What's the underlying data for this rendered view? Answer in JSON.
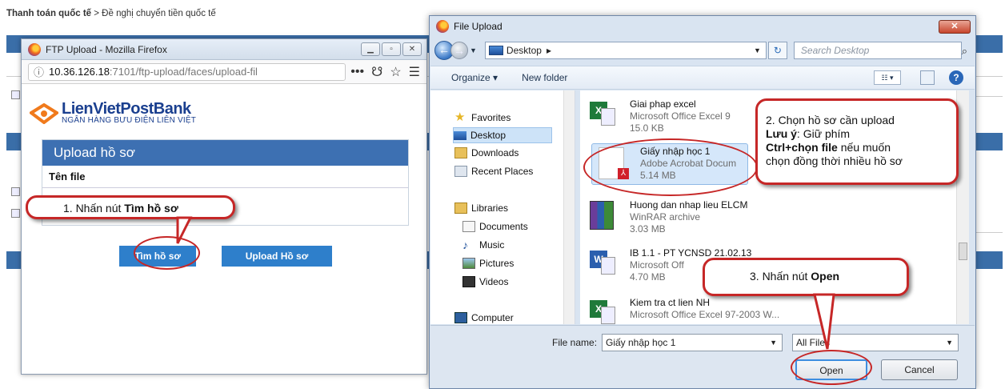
{
  "breadcrumb": {
    "bold": "Thanh toán quốc tế",
    "sep": " > ",
    "rest": "Đề nghị chuyển tiền quốc tế"
  },
  "ftp_window": {
    "title": "FTP Upload - Mozilla Firefox",
    "url_host": "10.36.126.18",
    "url_rest": ":7101/ftp-upload/faces/upload-fil",
    "bank_name": "LienVietPostBank",
    "bank_sub": "NGÂN HÀNG BƯU ĐIỆN LIÊN VIỆT",
    "panel_title": "Upload hồ sơ",
    "column": "Tên file",
    "find_button": "Tìm hồ sơ",
    "upload_button": "Upload Hồ sơ"
  },
  "dialog": {
    "title": "File Upload",
    "path": "Desktop",
    "search_placeholder": "Search Desktop",
    "organize": "Organize ▾",
    "new_folder": "New folder",
    "tree": [
      {
        "label": "Favorites",
        "icon": "star-icon"
      },
      {
        "label": "Desktop",
        "icon": "desktop-icon"
      },
      {
        "label": "Downloads",
        "icon": "downloads-icon"
      },
      {
        "label": "Recent Places",
        "icon": "recent-places-icon"
      },
      {
        "label": "Libraries",
        "icon": "libraries-icon"
      },
      {
        "label": "Documents",
        "icon": "documents-icon"
      },
      {
        "label": "Music",
        "icon": "music-icon"
      },
      {
        "label": "Pictures",
        "icon": "pictures-icon"
      },
      {
        "label": "Videos",
        "icon": "videos-icon"
      },
      {
        "label": "Computer",
        "icon": "computer-icon"
      }
    ],
    "files": [
      {
        "name": "Giai phap excel",
        "type": "Microsoft Office Excel 9",
        "size": "15.0 KB",
        "icon": "excel-icon"
      },
      {
        "name": "Giấy nhập học 1",
        "type": "Adobe Acrobat Docum",
        "size": "5.14 MB",
        "icon": "pdf-icon"
      },
      {
        "name": "Huong dan nhap lieu ELCM",
        "type": "WinRAR archive",
        "size": "3.03 MB",
        "icon": "winrar-icon"
      },
      {
        "name": "IB 1.1 - PT YCNSD 21.02.13",
        "type": "Microsoft Off",
        "size": "4.70 MB",
        "icon": "word-icon"
      },
      {
        "name": "Kiem tra ct lien NH",
        "type": "Microsoft Office Excel 97-2003 W...",
        "size": "",
        "icon": "excel-icon"
      }
    ],
    "filename_label": "File name:",
    "filename_value": "Giấy nhập học 1",
    "filter_value": "All Files",
    "open_button": "Open",
    "cancel_button": "Cancel"
  },
  "callouts": {
    "step1_text": "1. Nhấn nút ",
    "step1_bold": "Tìm hồ sơ",
    "step2_line1": "2. Chọn hồ sơ cần upload",
    "step2_bold1": "Lưu ý",
    "step2_line2": ": Giữ phím",
    "step2_bold2": "Ctrl+chọn file",
    "step2_line3": " nếu muốn",
    "step2_line4": "chọn đồng thời nhiều hồ sơ",
    "step3_text": "3. Nhấn nút ",
    "step3_bold": "Open"
  },
  "colors": {
    "accent": "#3d70b2",
    "callout_border": "#c62727",
    "button_blue": "#2e7fcb"
  }
}
